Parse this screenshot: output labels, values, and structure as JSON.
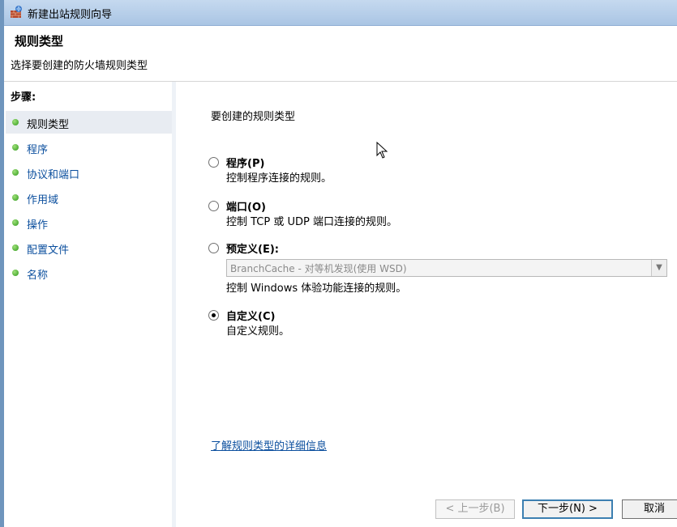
{
  "window": {
    "title": "新建出站规则向导"
  },
  "header": {
    "title": "规则类型",
    "subtitle": "选择要创建的防火墙规则类型"
  },
  "steps": {
    "title": "步骤:",
    "items": [
      {
        "label": "规则类型"
      },
      {
        "label": "程序"
      },
      {
        "label": "协议和端口"
      },
      {
        "label": "作用域"
      },
      {
        "label": "操作"
      },
      {
        "label": "配置文件"
      },
      {
        "label": "名称"
      }
    ]
  },
  "content": {
    "prompt": "要创建的规则类型",
    "options": [
      {
        "title": "程序(P)",
        "description": "控制程序连接的规则。",
        "checked": false
      },
      {
        "title": "端口(O)",
        "description": "控制 TCP 或 UDP 端口连接的规则。",
        "checked": false
      },
      {
        "title": "预定义(E):",
        "description": "控制 Windows 体验功能连接的规则。",
        "checked": false
      },
      {
        "title": "自定义(C)",
        "description": "自定义规则。",
        "checked": true
      }
    ],
    "predefined_dropdown": {
      "selected": "BranchCache - 对等机发现(使用 WSD)"
    },
    "learn_more_link": "了解规则类型的详细信息"
  },
  "buttons": {
    "back": "< 上一步(B)",
    "next": "下一步(N) >",
    "cancel": "取消"
  }
}
